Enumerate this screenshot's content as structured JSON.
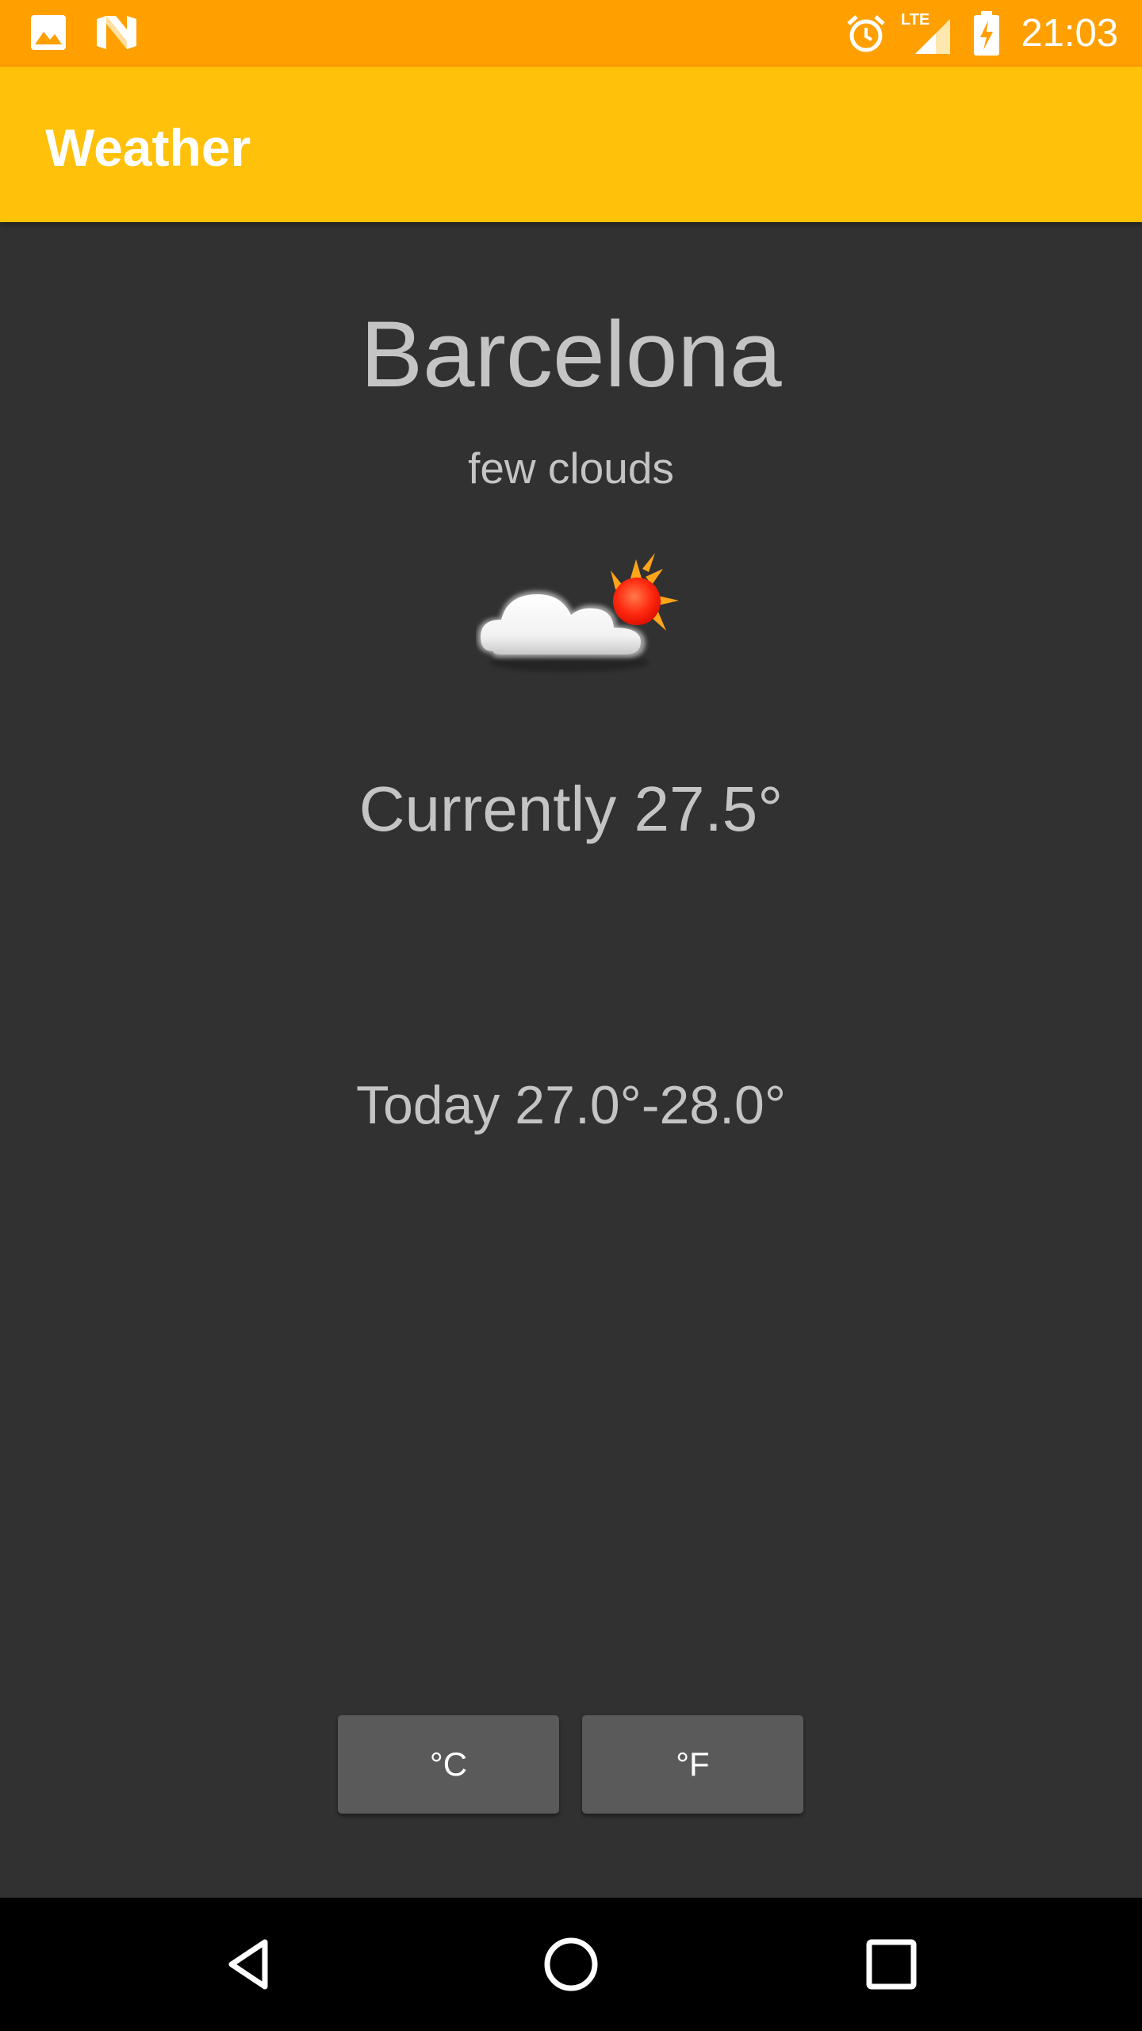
{
  "status_bar": {
    "time": "21:03",
    "network_label": "LTE",
    "icons": [
      "image-icon",
      "n-logo-icon",
      "alarm-icon",
      "lte-signal-icon",
      "battery-charging-icon"
    ],
    "background": "#ff9f00"
  },
  "app_bar": {
    "title": "Weather",
    "background": "#ffc10a"
  },
  "weather": {
    "city": "Barcelona",
    "description": "few clouds",
    "icon": "few-clouds-icon",
    "current": "Currently 27.5°",
    "today": "Today 27.0°-28.0°"
  },
  "units": {
    "celsius_label": "°C",
    "fahrenheit_label": "°F"
  },
  "nav_bar": {
    "buttons": [
      "back-icon",
      "home-icon",
      "recents-icon"
    ]
  },
  "colors": {
    "background": "#313131",
    "text": "#c4c4c4",
    "button": "#5a5a5a"
  }
}
